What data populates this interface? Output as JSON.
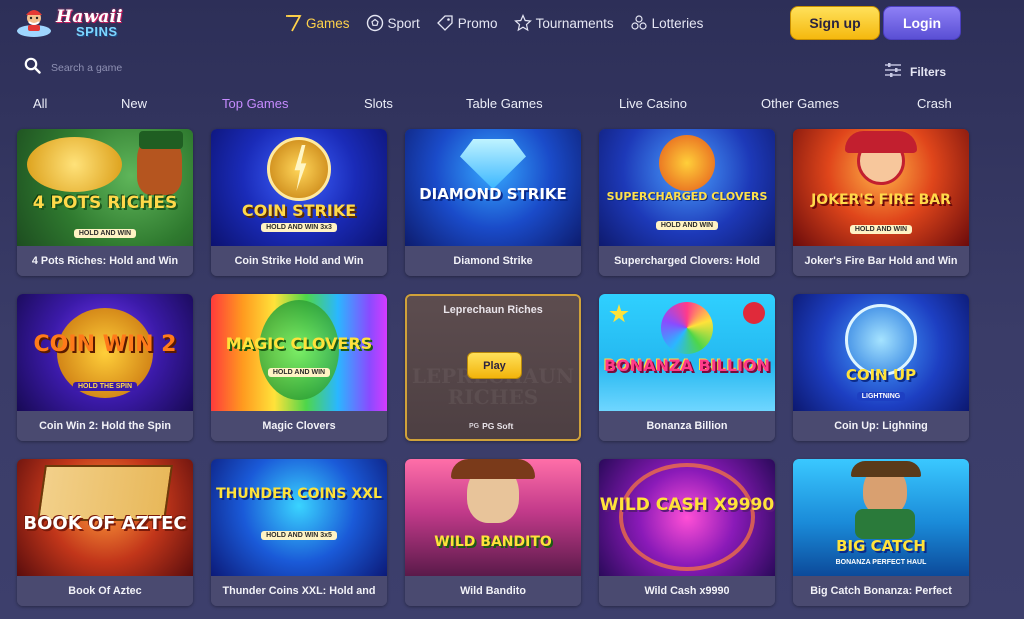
{
  "brand": {
    "name": "Hawaii",
    "sub": "SPINS"
  },
  "nav": [
    {
      "label": "Games",
      "icon": "seven-icon",
      "active": true
    },
    {
      "label": "Sport",
      "icon": "soccer-ball-icon"
    },
    {
      "label": "Promo",
      "icon": "tag-icon"
    },
    {
      "label": "Tournaments",
      "icon": "star-icon"
    },
    {
      "label": "Lotteries",
      "icon": "lottery-balls-icon"
    }
  ],
  "auth": {
    "signup_label": "Sign up",
    "login_label": "Login"
  },
  "search": {
    "placeholder": "Search a game"
  },
  "filters": {
    "label": "Filters"
  },
  "categories": [
    {
      "label": "All"
    },
    {
      "label": "New"
    },
    {
      "label": "Top Games",
      "active": true
    },
    {
      "label": "Slots"
    },
    {
      "label": "Table Games"
    },
    {
      "label": "Live Casino"
    },
    {
      "label": "Other Games"
    },
    {
      "label": "Crash"
    }
  ],
  "games": [
    {
      "label": "4 Pots Riches: Hold and Win",
      "art_title": "4 POTS RICHES",
      "art_sub": "HOLD AND WIN"
    },
    {
      "label": "Coin Strike Hold and Win",
      "art_title": "COIN STRIKE",
      "art_sub": "HOLD AND WIN 3x3"
    },
    {
      "label": "Diamond Strike",
      "art_title": "DIAMOND STRIKE"
    },
    {
      "label": "Supercharged Clovers: Hold",
      "art_title": "SUPERCHARGED CLOVERS",
      "art_sub": "HOLD AND WIN"
    },
    {
      "label": "Joker's Fire Bar Hold and Win",
      "art_title": "JOKER'S FIRE BAR",
      "art_sub": "HOLD AND WIN"
    },
    {
      "label": "Coin Win 2: Hold the Spin",
      "art_title": "COIN WIN 2",
      "art_sub": "HOLD THE SPIN"
    },
    {
      "label": "Magic Clovers",
      "art_title": "MAGIC CLOVERS",
      "art_sub": "HOLD AND WIN"
    },
    {
      "hover_title": "Leprechaun Riches",
      "play_label": "Play",
      "provider": "PG Soft",
      "provider_mark": "PG",
      "art_title": "LEPRECHAUN RICHES"
    },
    {
      "label": "Bonanza Billion",
      "art_title": "BONANZA BILLION"
    },
    {
      "label": "Coin Up: Lighning",
      "art_title": "COIN UP",
      "art_sub": "LIGHTNING"
    },
    {
      "label": "Book Of Aztec",
      "art_title": "BOOK OF AZTEC"
    },
    {
      "label": "Thunder Coins XXL: Hold and",
      "art_title": "THUNDER COINS XXL",
      "art_sub": "HOLD AND WIN 3x5"
    },
    {
      "label": "Wild Bandito",
      "art_title": "WILD BANDITO"
    },
    {
      "label": "Wild Cash x9990",
      "art_title": "WILD CASH X9990"
    },
    {
      "label": "Big Catch Bonanza: Perfect",
      "art_title": "BIG CATCH",
      "art_sub": "BONANZA PERFECT HAUL"
    }
  ]
}
